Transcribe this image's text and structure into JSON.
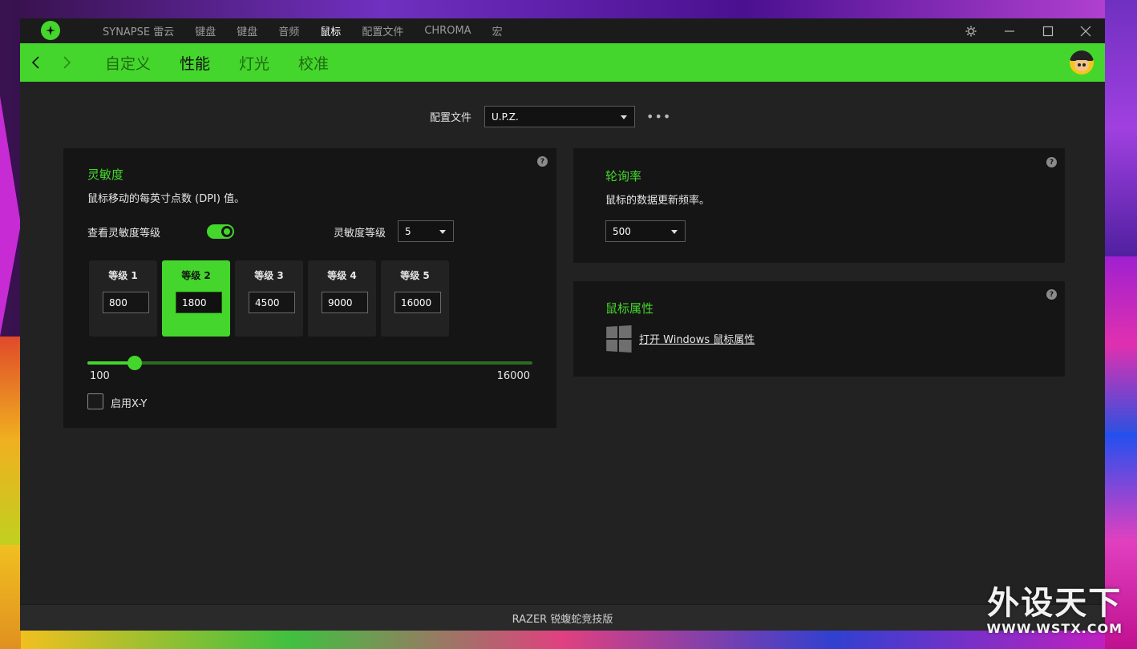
{
  "colors": {
    "accent": "#44d62c",
    "window_bg": "#222222",
    "panel_bg": "#151515"
  },
  "topnav": {
    "items": [
      {
        "label": "SYNAPSE 雷云"
      },
      {
        "label": "键盘"
      },
      {
        "label": "键盘"
      },
      {
        "label": "音频"
      },
      {
        "label": "鼠标",
        "active": true
      },
      {
        "label": "配置文件"
      },
      {
        "label": "CHROMA"
      },
      {
        "label": "宏"
      }
    ],
    "window_controls": [
      "settings-icon",
      "minimize-icon",
      "maximize-icon",
      "close-icon"
    ]
  },
  "subnav": {
    "tabs": [
      {
        "label": "自定义"
      },
      {
        "label": "性能",
        "active": true
      },
      {
        "label": "灯光"
      },
      {
        "label": "校准"
      }
    ]
  },
  "profile": {
    "label": "配置文件",
    "value": "U.P.Z.",
    "more": "•••"
  },
  "sensitivity": {
    "title": "灵敏度",
    "description": "鼠标移动的每英寸点数 (DPI) 值。",
    "stages_toggle_label": "查看灵敏度等级",
    "stages_toggle_on": true,
    "stage_count_label": "灵敏度等级",
    "stage_count_value": "5",
    "stages": [
      {
        "label": "等级 1",
        "value": "800"
      },
      {
        "label": "等级 2",
        "value": "1800",
        "active": true
      },
      {
        "label": "等级 3",
        "value": "4500"
      },
      {
        "label": "等级 4",
        "value": "9000"
      },
      {
        "label": "等级 5",
        "value": "16000"
      }
    ],
    "slider": {
      "min": "100",
      "max": "16000",
      "value": 1800
    },
    "xy_label": "启用X-Y",
    "xy_enabled": false,
    "help": "?"
  },
  "polling": {
    "title": "轮询率",
    "description": "鼠标的数据更新频率。",
    "value": "500",
    "help": "?"
  },
  "mouse_props": {
    "title": "鼠标属性",
    "link": "打开 Windows 鼠标属性",
    "help": "?"
  },
  "footer": {
    "device": "RAZER 锐蝮蛇竞技版"
  },
  "watermark": {
    "big": "外设天下",
    "small": "WWW.WSTX.COM"
  }
}
